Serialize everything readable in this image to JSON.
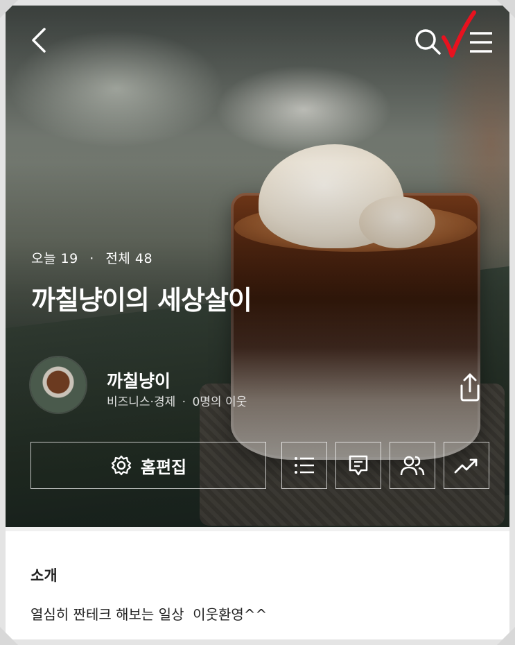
{
  "colors": {
    "accent_check": "#e8121f",
    "overlay_text": "#ffffff",
    "intro_text": "#222222"
  },
  "header": {
    "icons": [
      "chevron-left-icon",
      "search-icon",
      "hamburger-menu-icon"
    ]
  },
  "blog": {
    "stats": {
      "today_label": "오늘",
      "today_count": "19",
      "total_label": "전체",
      "total_count": "48",
      "separator": "·"
    },
    "title": "까칠냥이의 세상살이",
    "profile": {
      "nickname": "까칠냥이",
      "category": "비즈니스·경제",
      "separator": "·",
      "neighbors": "0명의 이웃"
    }
  },
  "actions": {
    "edit_home_label": "홈편집",
    "icon_buttons": [
      "list-icon",
      "comment-icon",
      "neighbors-icon",
      "stats-trend-icon"
    ]
  },
  "intro": {
    "heading": "소개",
    "text": "열심히 짠테크 해보는 일상  이웃환영^^"
  }
}
